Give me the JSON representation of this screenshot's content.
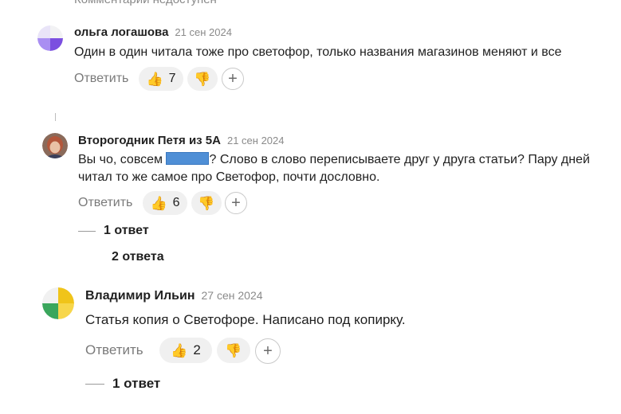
{
  "clipped_top_text": "Комментарий недоступен",
  "clipped_mid_text": "2 ответа",
  "colors": {
    "redaction": "#4f8fd6",
    "pill_bg": "#f0f0f0"
  },
  "comments": [
    {
      "author": "ольга логашова",
      "date": "21 сен 2024",
      "text": "Один в один читала тоже про светофор, только названия магазинов меняют и все",
      "reply_label": "Ответить",
      "likes_icon": "thumbs-up-icon",
      "likes": "7",
      "dislike_icon": "thumbs-down-icon",
      "add_reaction": "+"
    },
    {
      "author": "Второгодник Петя из 5А",
      "date": "21 сен 2024",
      "text_before": "Вы чо, совсем ",
      "text_after": "? Слово в слово переписываете друг у друга статьи? Пару дней читал то же самое про Светофор, почти дословно.",
      "reply_label": "Ответить",
      "likes": "6",
      "add_reaction": "+",
      "replies": "1 ответ"
    },
    {
      "author": "Владимир Ильин",
      "date": "27 сен 2024",
      "text": "Статья копия о Светофоре. Написано под копирку.",
      "reply_label": "Ответить",
      "likes": "2",
      "add_reaction": "+",
      "replies": "1 ответ"
    }
  ]
}
